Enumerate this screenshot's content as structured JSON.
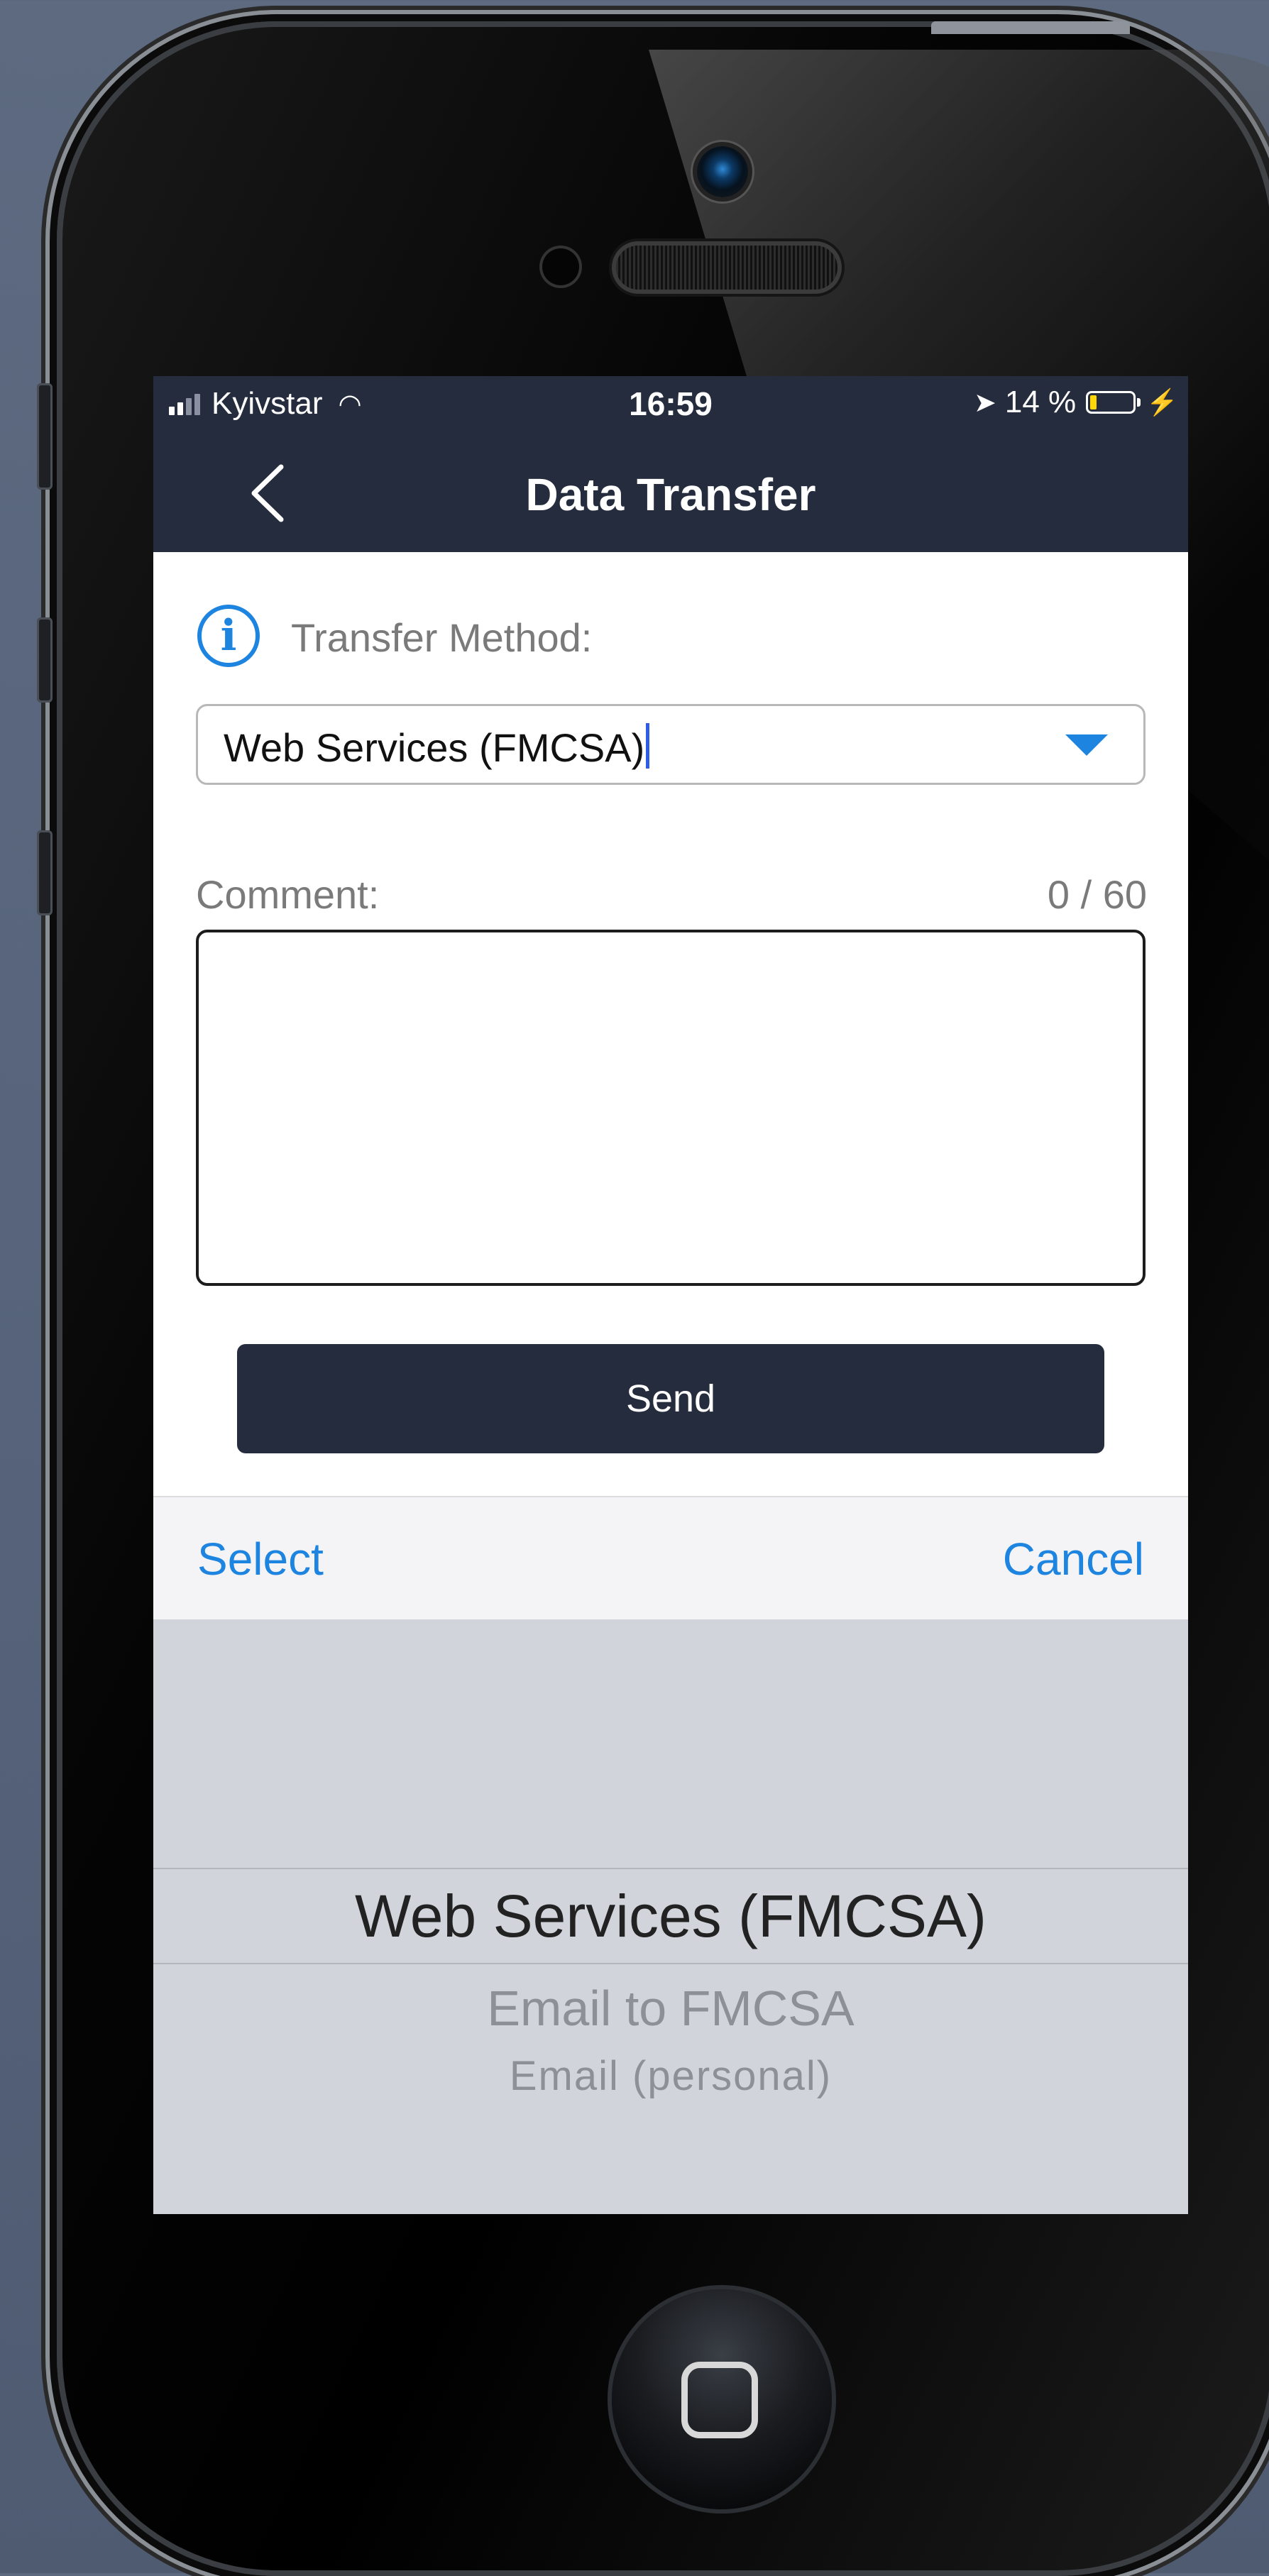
{
  "status_bar": {
    "carrier": "Kyivstar",
    "time": "16:59",
    "battery_percent": "14 %",
    "battery_level": 0.14
  },
  "nav": {
    "title": "Data Transfer"
  },
  "form": {
    "transfer_method_label": "Transfer Method:",
    "transfer_method_value": "Web Services (FMCSA)",
    "comment_label": "Comment:",
    "comment_counter": "0 / 60",
    "comment_value": "",
    "send_label": "Send"
  },
  "picker_toolbar": {
    "select_label": "Select",
    "cancel_label": "Cancel"
  },
  "picker": {
    "options": [
      "Web Services (FMCSA)",
      "Email to FMCSA",
      "Email (personal)"
    ],
    "selected_index": 0
  },
  "colors": {
    "header_bg": "#252c3d",
    "accent_blue": "#1d84e0",
    "picker_bg": "#d1d4db",
    "battery_low": "#ffd60a"
  },
  "icons": [
    "wifi-icon",
    "location-arrow-icon",
    "battery-icon",
    "charging-bolt-icon",
    "back-chevron-icon",
    "info-icon",
    "dropdown-arrow-icon"
  ]
}
